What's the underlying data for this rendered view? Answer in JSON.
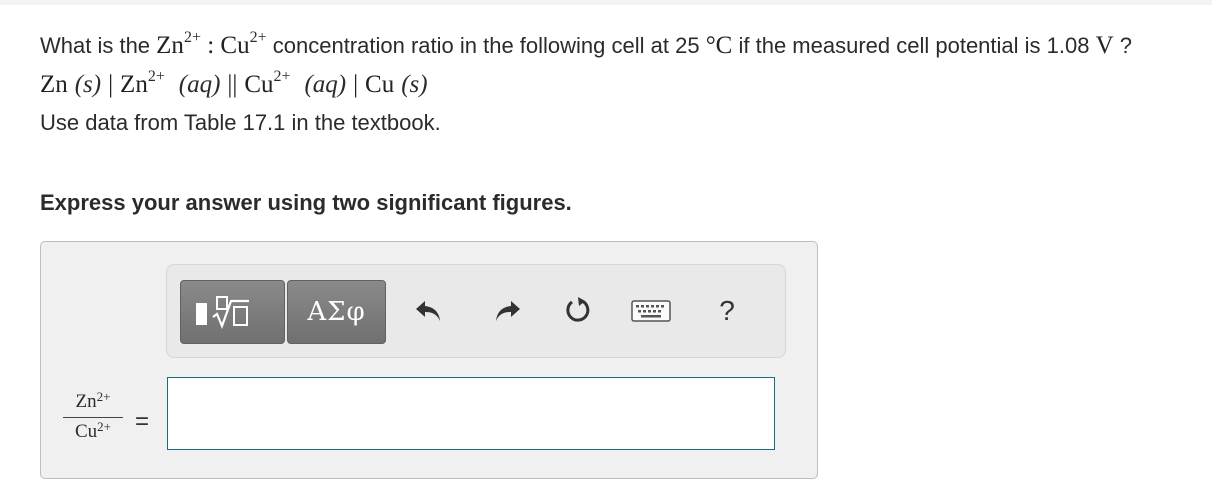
{
  "question": {
    "prefix": "What is the ",
    "ion1_base": "Zn",
    "ion1_charge": "2+",
    "ratio_sep": " : ",
    "ion2_base": "Cu",
    "ion2_charge": "2+",
    "middle": " concentration ratio in the following cell at 25 ",
    "temp_unit": "°C",
    "tail": " if the measured cell potential is 1.08 ",
    "volt_unit": "V",
    "end": " ?",
    "cell": {
      "anode": "Zn",
      "s1": "(s)",
      "sep1": "|",
      "ion1": "Zn",
      "ion1_charge": "2+",
      "aq1": "(aq)",
      "salt_bridge": "||",
      "ion2": "Cu",
      "ion2_charge": "2+",
      "aq2": "(aq)",
      "sep2": "|",
      "cathode": "Cu",
      "s2": "(s)"
    },
    "note": "Use data from Table 17.1 in the textbook."
  },
  "instruction": "Express your answer using two significant figures.",
  "toolbar": {
    "greek_label": "ΑΣφ",
    "help_label": "?"
  },
  "answer": {
    "numerator": "Zn",
    "numerator_charge": "2+",
    "denominator": "Cu",
    "denominator_charge": "2+",
    "equals": "=",
    "value": ""
  }
}
